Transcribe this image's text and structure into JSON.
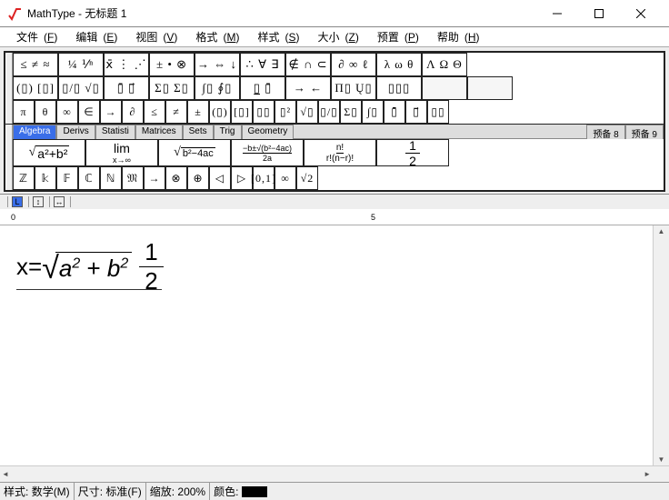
{
  "window": {
    "title": "MathType - 无标题 1",
    "buttons": {
      "min": "minimize",
      "max": "maximize",
      "close": "close"
    }
  },
  "menu": {
    "items": [
      {
        "label": "文件",
        "key": "F"
      },
      {
        "label": "编辑",
        "key": "E"
      },
      {
        "label": "视图",
        "key": "V"
      },
      {
        "label": "格式",
        "key": "M"
      },
      {
        "label": "样式",
        "key": "S"
      },
      {
        "label": "大小",
        "key": "Z"
      },
      {
        "label": "预置",
        "key": "P"
      },
      {
        "label": "帮助",
        "key": "H"
      }
    ]
  },
  "palette": {
    "row1": [
      "≤ ≠ ≈",
      "¼ ⅟ⁿ",
      "ⅹ̄ ⋮ ⋰",
      "± • ⊗",
      "→ ⇔ ↓",
      "∴ ∀ ∃",
      "∉ ∩ ⊂",
      "∂ ∞ ℓ",
      "λ ω θ",
      "Λ Ω Θ"
    ],
    "row2": [
      "(▯) [▯]",
      "▯/▯  √▯",
      "▯̄  ▯⃗",
      "Σ▯ Σ▯",
      "∫▯ ∮▯",
      "▯̲  ▯̄",
      "→  ←",
      "Π▯ Ų▯",
      "▯▯▯",
      "",
      ""
    ],
    "row3": [
      "π",
      "θ",
      "∞",
      "∈",
      "→",
      "∂",
      "≤",
      "≠",
      "±",
      "(▯)",
      "[▯]",
      "▯▯",
      "▯²",
      "√▯",
      "▯/▯",
      "Σ▯",
      "∫▯",
      "▯̄",
      "▯⃗",
      "▯▯"
    ],
    "tabs": [
      "Algebra",
      "Derivs",
      "Statisti",
      "Matrices",
      "Sets",
      "Trig",
      "Geometry",
      "预备 8",
      "预备 9"
    ],
    "row4": [
      "√(a²+b²)",
      "lim x→∞",
      "√(b²−4ac)",
      "(−b±√(b²−4ac))/2a",
      "n! / r!(n−r)!",
      "1/2"
    ],
    "row5": [
      "ℤ",
      "𝕜",
      "𝔽",
      "ℂ",
      "ℕ",
      "𝔐",
      "→",
      "⊗",
      "⊕",
      "◁",
      "▷",
      "[0,1]",
      "∞",
      "√2"
    ]
  },
  "ruler": {
    "marks": [
      "0",
      "5"
    ],
    "unit": ""
  },
  "formula": {
    "lhs": "x",
    "eq": "=",
    "radicand_a": "a",
    "radicand_plus": " + ",
    "radicand_b": "b",
    "sup": "2",
    "frac_num": "1",
    "frac_den": "2"
  },
  "status": {
    "style_label": "样式:",
    "style_value": "数学(M)",
    "size_label": "尺寸:",
    "size_value": "标准(F)",
    "zoom_label": "缩放:",
    "zoom_value": "200%",
    "color_label": "颜色:",
    "color_value": "#000000"
  }
}
